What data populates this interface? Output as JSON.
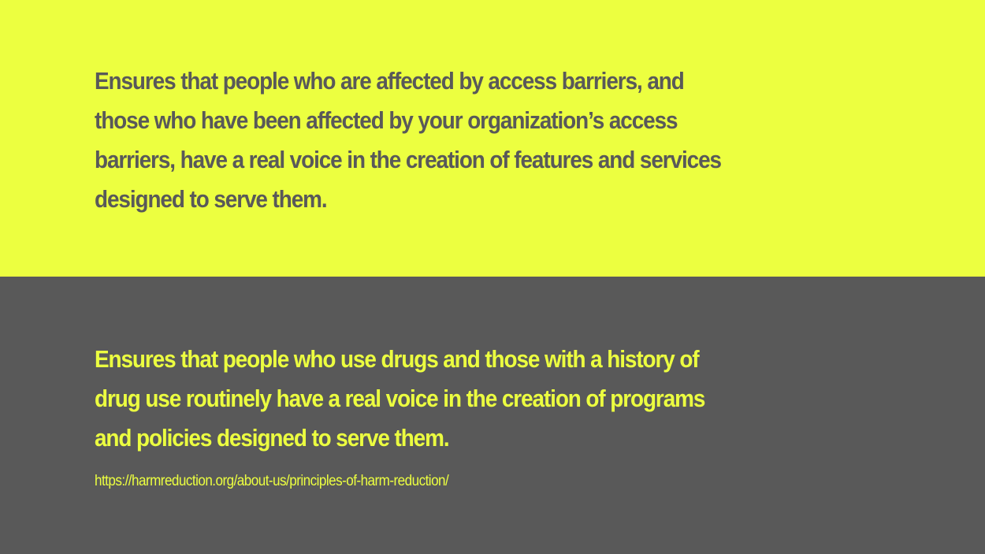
{
  "colors": {
    "yellow": "#ecff40",
    "gray": "#595959"
  },
  "top_panel": {
    "lines": [
      "Ensures that people who are affected by access barriers, and",
      "those who have been affected by your organization’s access",
      "barriers, have a real voice in the creation of features and services",
      "designed to serve them."
    ]
  },
  "bottom_panel": {
    "lines": [
      "Ensures that people who use drugs and those with a history of",
      "drug use routinely have a real voice in the creation of programs",
      "and policies designed to serve them."
    ],
    "source_url": "https://harmreduction.org/about-us/principles-of-harm-reduction/"
  }
}
